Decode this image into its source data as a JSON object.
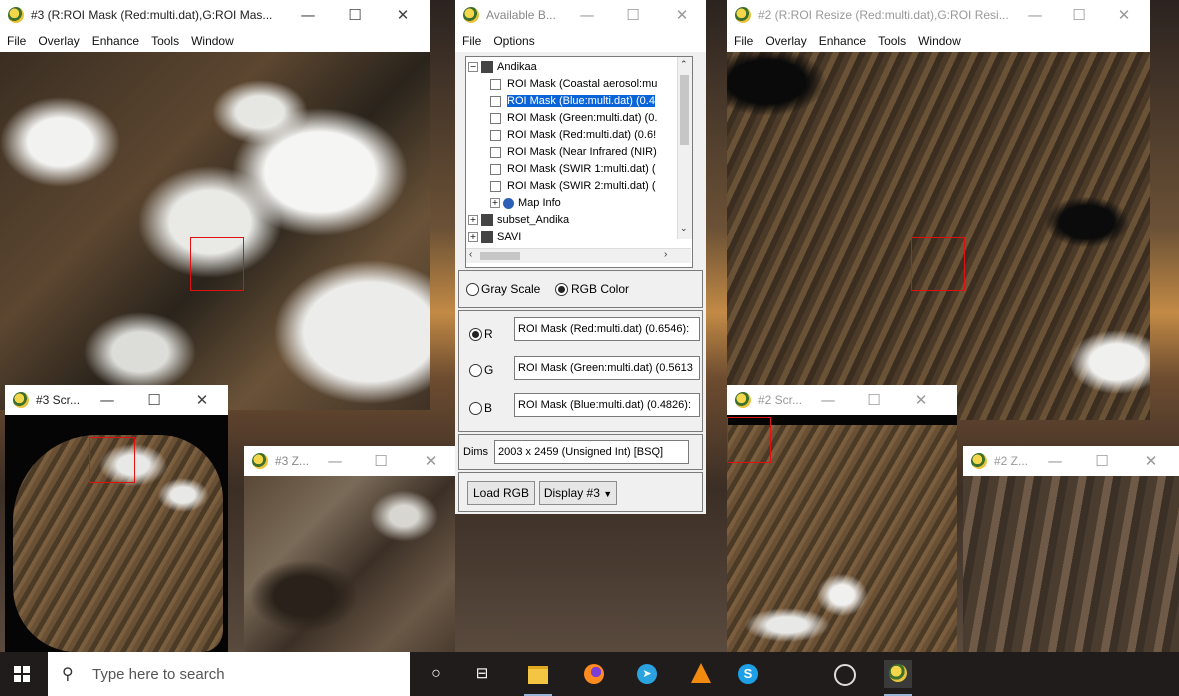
{
  "window3": {
    "title": "#3 (R:ROI Mask (Red:multi.dat),G:ROI Mas...",
    "menu": [
      "File",
      "Overlay",
      "Enhance",
      "Tools",
      "Window"
    ],
    "min_icon": "minimize-icon",
    "max_icon": "maximize-icon",
    "close_icon": "close-icon"
  },
  "window2": {
    "title": "#2 (R:ROI Resize (Red:multi.dat),G:ROI Resi...",
    "menu": [
      "File",
      "Overlay",
      "Enhance",
      "Tools",
      "Window"
    ]
  },
  "scroll3": {
    "title": "#3 Scr..."
  },
  "zoom3": {
    "title": "#3 Z..."
  },
  "scroll2": {
    "title": "#2 Scr..."
  },
  "zoom2": {
    "title": "#2 Z..."
  },
  "bands": {
    "title": "Available B...",
    "menu": [
      "File",
      "Options"
    ],
    "tree": [
      {
        "label": "Andikaa",
        "level": 0,
        "expand": "−"
      },
      {
        "label": "ROI Mask (Coastal aerosol:mu",
        "level": 1
      },
      {
        "label": "ROI Mask (Blue:multi.dat) (0.4",
        "level": 1,
        "selected": true
      },
      {
        "label": "ROI Mask (Green:multi.dat) (0.",
        "level": 1
      },
      {
        "label": "ROI Mask (Red:multi.dat) (0.6!",
        "level": 1
      },
      {
        "label": "ROI Mask (Near Infrared (NIR)",
        "level": 1
      },
      {
        "label": "ROI Mask (SWIR 1:multi.dat) (",
        "level": 1
      },
      {
        "label": "ROI Mask (SWIR 2:multi.dat) (",
        "level": 1
      },
      {
        "label": "Map Info",
        "level": 1,
        "expand": "+"
      },
      {
        "label": "subset_Andika",
        "level": 0,
        "expand": "+"
      },
      {
        "label": "SAVI",
        "level": 0,
        "expand": "+"
      }
    ],
    "gray_scale": "Gray Scale",
    "rgb_color": "RGB Color",
    "r_label": "R",
    "g_label": "G",
    "b_label": "B",
    "r_value": "ROI Mask (Red:multi.dat) (0.6546):",
    "g_value": "ROI Mask (Green:multi.dat) (0.5613",
    "b_value": "ROI Mask (Blue:multi.dat) (0.4826):",
    "dims_label": "Dims",
    "dims_value": "2003 x 2459 (Unsigned Int) [BSQ]",
    "load_rgb": "Load RGB",
    "display": "Display #3"
  },
  "taskbar": {
    "search_placeholder": "Type here to search"
  },
  "colors": {
    "selection": "#0a64d8",
    "roi_box": "#e01010",
    "taskbar": "#1f1c1b"
  }
}
